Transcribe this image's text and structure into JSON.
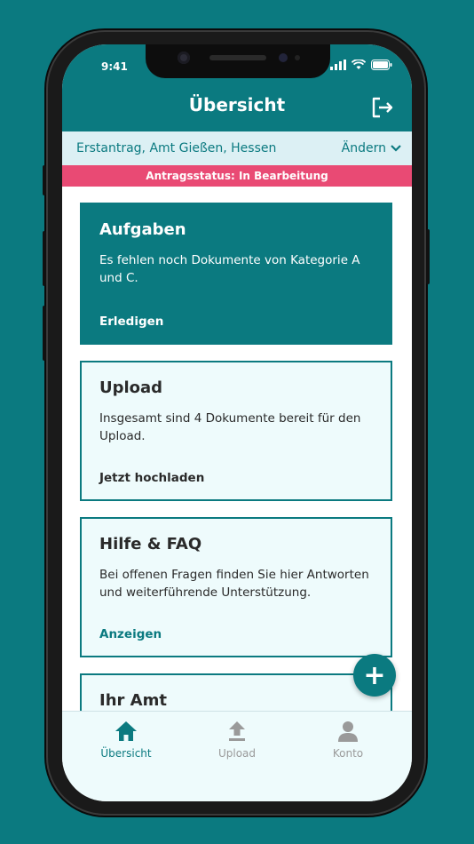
{
  "status_bar": {
    "time": "9:41"
  },
  "header": {
    "title": "Übersicht"
  },
  "location": {
    "text": "Erstantrag, Amt Gießen, Hessen",
    "change_label": "Ändern"
  },
  "application_status": "Antragsstatus: In Bearbeitung",
  "cards": [
    {
      "title": "Aufgaben",
      "text": "Es fehlen noch Dokumente von Kategorie A und C.",
      "action": "Erledigen"
    },
    {
      "title": "Upload",
      "text": "Insgesamt sind 4 Dokumente bereit für den Upload.",
      "action": "Jetzt hochladen"
    },
    {
      "title": "Hilfe & FAQ",
      "text": "Bei offenen Fragen finden Sie hier Antworten und weiterführende Unterstützung.",
      "action": "Anzeigen"
    },
    {
      "title": "Ihr Amt",
      "text": "",
      "action": ""
    }
  ],
  "fab": {
    "label": "+"
  },
  "tabs": [
    {
      "label": "Übersicht",
      "icon": "home-icon",
      "active": true
    },
    {
      "label": "Upload",
      "icon": "upload-icon",
      "active": false
    },
    {
      "label": "Konto",
      "icon": "user-icon",
      "active": false
    }
  ],
  "colors": {
    "primary": "#0b7a80",
    "status": "#e94a74",
    "light": "#dcf0f4",
    "card_bg": "#eefbfc"
  }
}
